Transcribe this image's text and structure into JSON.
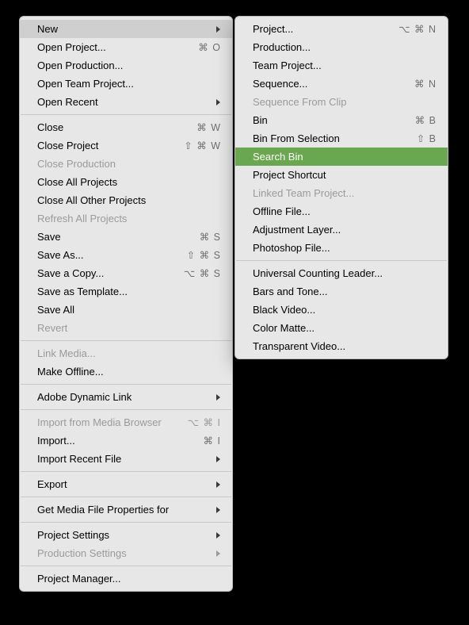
{
  "left_menu": {
    "groups": [
      [
        {
          "id": "new",
          "label": "New",
          "submenu": true,
          "highlight": "grey"
        },
        {
          "id": "open-project",
          "label": "Open Project...",
          "shortcut": "⌘ O"
        },
        {
          "id": "open-production",
          "label": "Open Production..."
        },
        {
          "id": "open-team-project",
          "label": "Open Team Project..."
        },
        {
          "id": "open-recent",
          "label": "Open Recent",
          "submenu": true
        }
      ],
      [
        {
          "id": "close",
          "label": "Close",
          "shortcut": "⌘ W"
        },
        {
          "id": "close-project",
          "label": "Close Project",
          "shortcut": "⇧ ⌘ W"
        },
        {
          "id": "close-production",
          "label": "Close Production",
          "disabled": true
        },
        {
          "id": "close-all-projects",
          "label": "Close All Projects"
        },
        {
          "id": "close-all-other-projects",
          "label": "Close All Other Projects"
        },
        {
          "id": "refresh-all-projects",
          "label": "Refresh All Projects",
          "disabled": true
        },
        {
          "id": "save",
          "label": "Save",
          "shortcut": "⌘ S"
        },
        {
          "id": "save-as",
          "label": "Save As...",
          "shortcut": "⇧ ⌘ S"
        },
        {
          "id": "save-a-copy",
          "label": "Save a Copy...",
          "shortcut": "⌥ ⌘ S"
        },
        {
          "id": "save-as-template",
          "label": "Save as Template..."
        },
        {
          "id": "save-all",
          "label": "Save All"
        },
        {
          "id": "revert",
          "label": "Revert",
          "disabled": true
        }
      ],
      [
        {
          "id": "link-media",
          "label": "Link Media...",
          "disabled": true
        },
        {
          "id": "make-offline",
          "label": "Make Offline..."
        }
      ],
      [
        {
          "id": "adobe-dynamic-link",
          "label": "Adobe Dynamic Link",
          "submenu": true
        }
      ],
      [
        {
          "id": "import-from-media-browser",
          "label": "Import from Media Browser",
          "shortcut": "⌥ ⌘ I",
          "disabled": true
        },
        {
          "id": "import",
          "label": "Import...",
          "shortcut": "⌘ I"
        },
        {
          "id": "import-recent-file",
          "label": "Import Recent File",
          "submenu": true
        }
      ],
      [
        {
          "id": "export",
          "label": "Export",
          "submenu": true
        }
      ],
      [
        {
          "id": "get-media-file-properties-for",
          "label": "Get Media File Properties for",
          "submenu": true
        }
      ],
      [
        {
          "id": "project-settings",
          "label": "Project Settings",
          "submenu": true
        },
        {
          "id": "production-settings",
          "label": "Production Settings",
          "submenu": true,
          "disabled": true
        }
      ],
      [
        {
          "id": "project-manager",
          "label": "Project Manager..."
        }
      ]
    ]
  },
  "right_menu": {
    "groups": [
      [
        {
          "id": "project",
          "label": "Project...",
          "shortcut": "⌥ ⌘ N"
        },
        {
          "id": "production",
          "label": "Production..."
        },
        {
          "id": "team-project",
          "label": "Team Project..."
        },
        {
          "id": "sequence",
          "label": "Sequence...",
          "shortcut": "⌘ N"
        },
        {
          "id": "sequence-from-clip",
          "label": "Sequence From Clip",
          "disabled": true
        },
        {
          "id": "bin",
          "label": "Bin",
          "shortcut": "⌘ B"
        },
        {
          "id": "bin-from-selection",
          "label": "Bin From Selection",
          "shortcut": "⇧ B"
        },
        {
          "id": "search-bin",
          "label": "Search Bin",
          "highlight": "green"
        },
        {
          "id": "project-shortcut",
          "label": "Project Shortcut"
        },
        {
          "id": "linked-team-project",
          "label": "Linked Team Project...",
          "disabled": true
        },
        {
          "id": "offline-file",
          "label": "Offline File..."
        },
        {
          "id": "adjustment-layer",
          "label": "Adjustment Layer..."
        },
        {
          "id": "photoshop-file",
          "label": "Photoshop File..."
        }
      ],
      [
        {
          "id": "universal-counting-leader",
          "label": "Universal Counting Leader..."
        },
        {
          "id": "bars-and-tone",
          "label": "Bars and Tone..."
        },
        {
          "id": "black-video",
          "label": "Black Video..."
        },
        {
          "id": "color-matte",
          "label": "Color Matte..."
        },
        {
          "id": "transparent-video",
          "label": "Transparent Video..."
        }
      ]
    ]
  }
}
